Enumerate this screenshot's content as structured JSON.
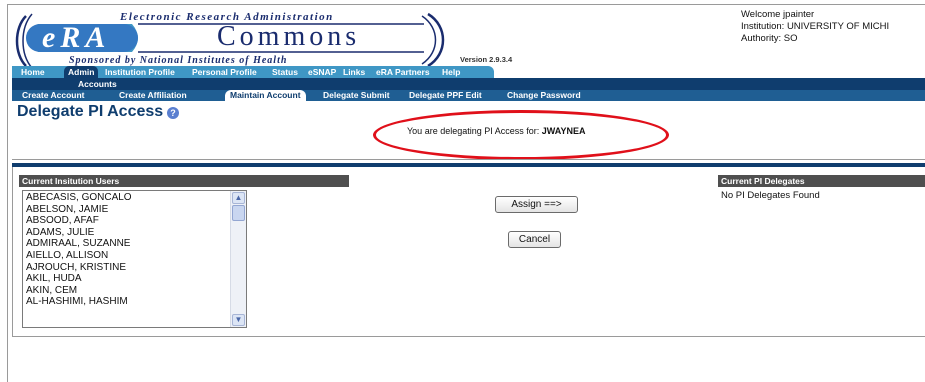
{
  "header": {
    "logo_title": "Electronic Research Administration",
    "logo_era": "eRA",
    "logo_commons": "Commons",
    "logo_subtitle": "Sponsored by National Institutes of Health",
    "version": "Version 2.9.3.4",
    "welcome": "Welcome jpainter",
    "institution": "Institution: UNIVERSITY OF MICHI",
    "authority": "Authority:  SO"
  },
  "nav": {
    "main": [
      "Home",
      "Admin",
      "Institution Profile",
      "Personal Profile",
      "Status",
      "eSNAP",
      "Links",
      "eRA Partners",
      "Help"
    ],
    "active_main": "Admin",
    "sub1": "Accounts",
    "sub2": [
      "Create Account",
      "Create Affiliation",
      "Maintain Account",
      "Delegate Submit",
      "Delegate PPF Edit",
      "Change Password"
    ],
    "active_sub2": "Maintain Account"
  },
  "page": {
    "title": "Delegate PI Access",
    "delegating_label": "You are delegating PI Access for:",
    "delegating_user": "JWAYNEA"
  },
  "left_panel": {
    "header": "Current Insitution Users",
    "users": [
      "ABECASIS, GONCALO",
      "ABELSON, JAMIE",
      "ABSOOD, AFAF",
      "ADAMS, JULIE",
      "ADMIRAAL, SUZANNE",
      "AIELLO, ALLISON",
      "AJROUCH, KRISTINE",
      "AKIL, HUDA",
      "AKIN, CEM",
      "AL-HASHIMI, HASHIM"
    ]
  },
  "actions": {
    "assign": "Assign ==>",
    "cancel": "Cancel"
  },
  "right_panel": {
    "header": "Current PI Delegates",
    "empty_text": "No PI Delegates Found"
  },
  "colors": {
    "brand_navy": "#0f3d6e",
    "nav_blue": "#3f97c5",
    "highlight_red": "#e0101a"
  }
}
